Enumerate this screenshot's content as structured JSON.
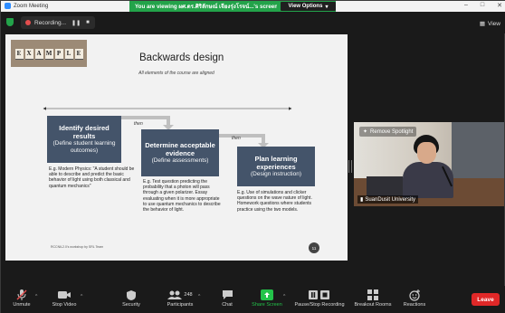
{
  "window": {
    "title": "Zoom Meeting",
    "share_banner": "You are viewing ผศ.ดร.ศิริลักษณ์ เจียงรุ่งโรจน์...'s screen",
    "view_options": "View Options",
    "controls": [
      "–",
      "□",
      "✕"
    ]
  },
  "topbar": {
    "recording": "Recording...",
    "view": "View",
    "pause_icon": "pause-icon",
    "stop_icon": "stop-icon"
  },
  "slide": {
    "example_letters": [
      "E",
      "X",
      "A",
      "M",
      "P",
      "L",
      "E"
    ],
    "title": "Backwards design",
    "subtitle": "All elements of the course are aligned",
    "boxes": [
      {
        "heading": "Identify desired results",
        "sub": "(Define student learning outcomes)"
      },
      {
        "heading": "Determine acceptable evidence",
        "sub": "(Define assessments)"
      },
      {
        "heading": "Plan learning experiences",
        "sub": "(Design instruction)"
      }
    ],
    "then1": "then",
    "then2": "then",
    "desc1": "E.g. Modern Physics: \"A student should be able to describe and predict the basic behavior of light using both classical and quantum mechanics\"",
    "desc2": "E.g. Test question predicting the probability that a photon will pass through a given polarizer. Essay evaluating when it is more appropriate to use quantum mechanics to describe the behavior of light.",
    "desc3": "E.g. Use of simulations and clicker questions on the wave nature of light. Homework questions where students practice using the two models.",
    "footer": "RCCNIL2.0's workshop by SRL Team",
    "page": "11"
  },
  "video": {
    "remove_spotlight": "Remove Spotlight",
    "name": "SuanDusit University"
  },
  "toolbar": {
    "items": [
      {
        "label": "Unmute",
        "icon": "microphone-muted-icon"
      },
      {
        "label": "Stop Video",
        "icon": "video-camera-icon"
      },
      {
        "label": "Security",
        "icon": "shield-icon"
      },
      {
        "label": "Participants",
        "icon": "participants-icon",
        "count": "248"
      },
      {
        "label": "Chat",
        "icon": "chat-icon"
      },
      {
        "label": "Share Screen",
        "icon": "share-screen-icon"
      },
      {
        "label": "Pause/Stop Recording",
        "icon": "recording-controls-icon"
      },
      {
        "label": "Breakout Rooms",
        "icon": "breakout-rooms-icon"
      },
      {
        "label": "Reactions",
        "icon": "reactions-icon"
      }
    ],
    "leave": "Leave"
  },
  "colors": {
    "banner": "#23a34a",
    "slide_box": "#44546a",
    "leave": "#e02828",
    "share_screen": "#23c34a"
  }
}
